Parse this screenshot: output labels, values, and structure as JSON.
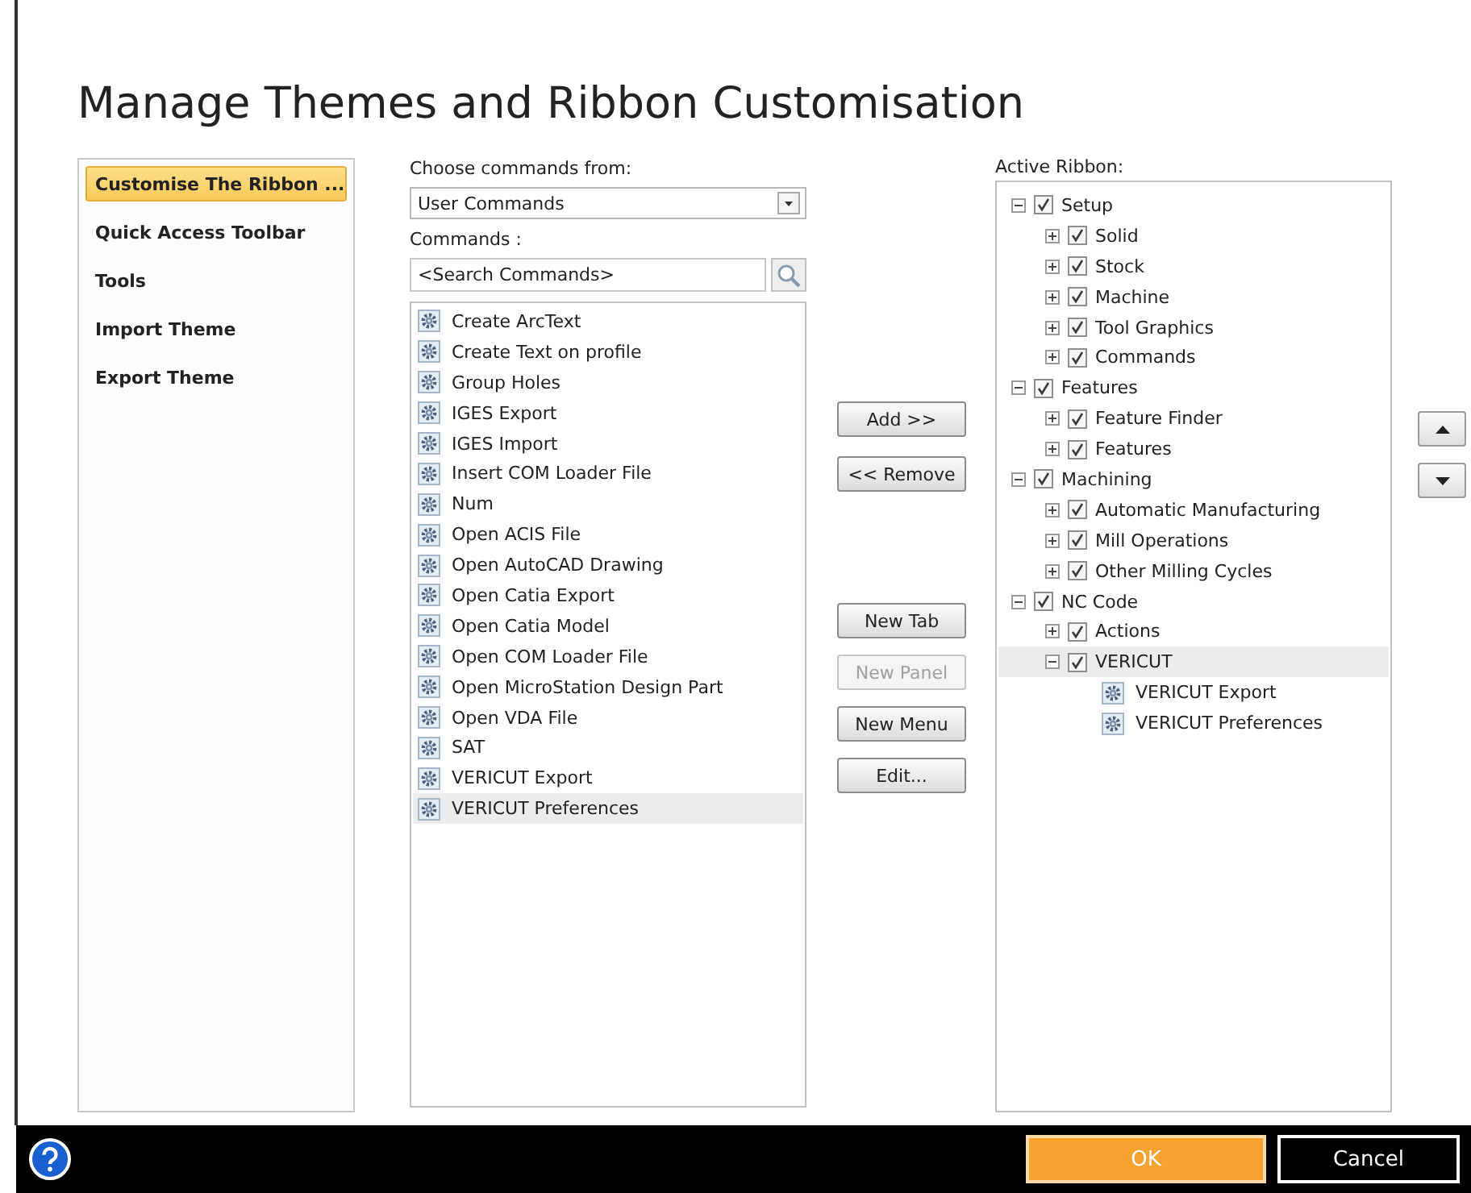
{
  "window": {
    "title": "Manage Themes and Ribbon Customisation"
  },
  "sidebar": {
    "items": [
      {
        "label": "Customise The Ribbon ...",
        "selected": true
      },
      {
        "label": "Quick Access Toolbar",
        "selected": false
      },
      {
        "label": "Tools",
        "selected": false
      },
      {
        "label": "Import Theme",
        "selected": false
      },
      {
        "label": "Export Theme",
        "selected": false
      }
    ]
  },
  "commands_panel": {
    "source_label": "Choose commands from:",
    "source": {
      "value": "User Commands"
    },
    "commands_label": "Commands :",
    "search": {
      "placeholder": "<Search Commands>"
    },
    "items": [
      {
        "label": "Create ArcText",
        "selected": false
      },
      {
        "label": "Create Text on profile",
        "selected": false
      },
      {
        "label": "Group Holes",
        "selected": false
      },
      {
        "label": "IGES Export",
        "selected": false
      },
      {
        "label": "IGES Import",
        "selected": false
      },
      {
        "label": "Insert COM Loader File",
        "selected": false
      },
      {
        "label": "Num",
        "selected": false
      },
      {
        "label": "Open ACIS File",
        "selected": false
      },
      {
        "label": "Open AutoCAD Drawing",
        "selected": false
      },
      {
        "label": "Open Catia Export",
        "selected": false
      },
      {
        "label": "Open Catia Model",
        "selected": false
      },
      {
        "label": "Open COM Loader File",
        "selected": false
      },
      {
        "label": "Open MicroStation Design Part",
        "selected": false
      },
      {
        "label": "Open VDA File",
        "selected": false
      },
      {
        "label": "SAT",
        "selected": false
      },
      {
        "label": "VERICUT Export",
        "selected": false
      },
      {
        "label": "VERICUT Preferences",
        "selected": true
      }
    ]
  },
  "actions": [
    {
      "label": "Add >>",
      "disabled": false
    },
    {
      "label": "<< Remove",
      "disabled": false
    },
    {
      "label": "New Tab",
      "disabled": false
    },
    {
      "label": "New Panel",
      "disabled": true
    },
    {
      "label": "New Menu",
      "disabled": false
    },
    {
      "label": "Edit...",
      "disabled": false
    }
  ],
  "ribbon": {
    "label": "Active Ribbon:",
    "tree": [
      {
        "kind": "group",
        "label": "Setup",
        "expanded": true,
        "checked": true,
        "selected": false,
        "children": [
          {
            "kind": "group",
            "label": "Solid",
            "expanded": false,
            "checked": true,
            "selected": false
          },
          {
            "kind": "group",
            "label": "Stock",
            "expanded": false,
            "checked": true,
            "selected": false
          },
          {
            "kind": "group",
            "label": "Machine",
            "expanded": false,
            "checked": true,
            "selected": false
          },
          {
            "kind": "group",
            "label": "Tool Graphics",
            "expanded": false,
            "checked": true,
            "selected": false
          },
          {
            "kind": "group",
            "label": "Commands",
            "expanded": false,
            "checked": true,
            "selected": false
          }
        ]
      },
      {
        "kind": "group",
        "label": "Features",
        "expanded": true,
        "checked": true,
        "selected": false,
        "children": [
          {
            "kind": "group",
            "label": "Feature Finder",
            "expanded": false,
            "checked": true,
            "selected": false
          },
          {
            "kind": "group",
            "label": "Features",
            "expanded": false,
            "checked": true,
            "selected": false
          }
        ]
      },
      {
        "kind": "group",
        "label": "Machining",
        "expanded": true,
        "checked": true,
        "selected": false,
        "children": [
          {
            "kind": "group",
            "label": "Automatic Manufacturing",
            "expanded": false,
            "checked": true,
            "selected": false
          },
          {
            "kind": "group",
            "label": "Mill Operations",
            "expanded": false,
            "checked": true,
            "selected": false
          },
          {
            "kind": "group",
            "label": "Other Milling Cycles",
            "expanded": false,
            "checked": true,
            "selected": false
          }
        ]
      },
      {
        "kind": "group",
        "label": "NC Code",
        "expanded": true,
        "checked": true,
        "selected": false,
        "children": [
          {
            "kind": "group",
            "label": "Actions",
            "expanded": false,
            "checked": true,
            "selected": false
          },
          {
            "kind": "group",
            "label": "VERICUT",
            "expanded": true,
            "checked": true,
            "selected": true,
            "children": [
              {
                "kind": "command",
                "label": "VERICUT Export",
                "selected": false
              },
              {
                "kind": "command",
                "label": "VERICUT Preferences",
                "selected": false
              }
            ]
          }
        ]
      }
    ]
  },
  "footer": {
    "buttons": [
      {
        "label": "OK",
        "kind": "primary"
      },
      {
        "label": "Cancel",
        "kind": "secondary"
      }
    ]
  }
}
